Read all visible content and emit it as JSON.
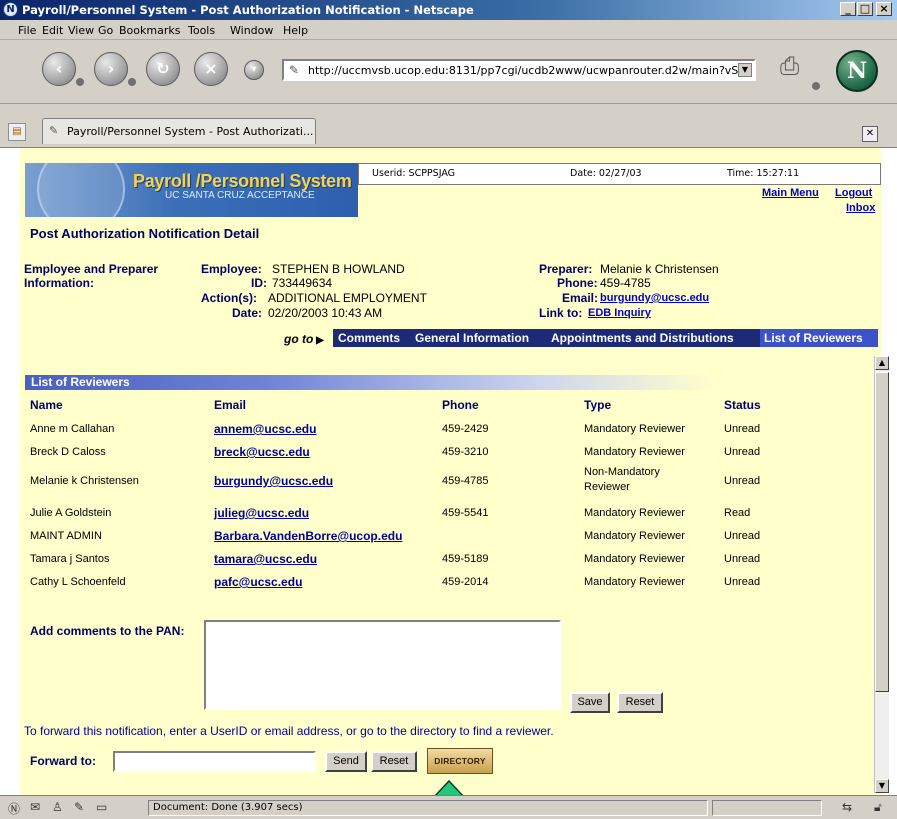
{
  "window": {
    "title": "Payroll/Personnel System - Post Authorization Notification - Netscape",
    "controls": [
      "_",
      "□",
      "×"
    ]
  },
  "menu": [
    "File",
    "Edit",
    "View",
    "Go",
    "Bookmarks",
    "Tools",
    "Window",
    "Help"
  ],
  "navigation": {
    "url": "http://uccmvsb.ucop.edu:8131/pp7cgi/ucdb2www/ucwpanrouter.d2w/main?vScr",
    "logo": "N"
  },
  "tab": {
    "title": "Payroll/Personnel System - Post Authorizati..."
  },
  "banner": {
    "title": "Payroll /Personnel System",
    "subtitle": "UC SANTA CRUZ ACCEPTANCE"
  },
  "session": {
    "userid": "Userid: SCPPSJAG",
    "date": "Date: 02/27/03",
    "time": "Time: 15:27:11"
  },
  "top_links": {
    "main_menu": "Main Menu",
    "logout": "Logout",
    "inbox": "Inbox"
  },
  "page_title": "Post Authorization Notification Detail",
  "details": {
    "section_label_line1": "Employee and Preparer",
    "section_label_line2": "Information:",
    "employee_label": "Employee:",
    "employee": "STEPHEN B HOWLAND",
    "id_label": "ID:",
    "id": "733449634",
    "actions_label": "Action(s):",
    "actions": "ADDITIONAL EMPLOYMENT",
    "date_label": "Date:",
    "date": "02/20/2003 10:43 AM",
    "preparer_label": "Preparer:",
    "preparer": "Melanie k Christensen",
    "phone_label": "Phone:",
    "phone": "459-4785",
    "email_label": "Email:",
    "email": "burgundy@ucsc.edu",
    "linkto_label": "Link to:",
    "linkto": "EDB Inquiry"
  },
  "goto": {
    "label": "go to",
    "items": [
      "Comments",
      "General Information",
      "Appointments and Distributions",
      "List of Reviewers"
    ],
    "active": "List of Reviewers"
  },
  "reviewers": {
    "heading": "List of Reviewers",
    "columns": [
      "Name",
      "Email",
      "Phone",
      "Type",
      "Status"
    ],
    "rows": [
      {
        "name": "Anne m Callahan",
        "email": "annem@ucsc.edu",
        "phone": "459-2429",
        "type": "Mandatory Reviewer",
        "status": "Unread"
      },
      {
        "name": "Breck D Caloss",
        "email": "breck@ucsc.edu",
        "phone": "459-3210",
        "type": "Mandatory Reviewer",
        "status": "Unread"
      },
      {
        "name": "Melanie k Christensen",
        "email": "burgundy@ucsc.edu",
        "phone": "459-4785",
        "type_line1": "Non-Mandatory",
        "type_line2": "Reviewer",
        "status": "Unread"
      },
      {
        "name": "Julie A Goldstein",
        "email": "julieg@ucsc.edu",
        "phone": "459-5541",
        "type": "Mandatory Reviewer",
        "status": "Read"
      },
      {
        "name": "MAINT ADMIN",
        "email": "Barbara.VandenBorre@ucop.edu",
        "phone": "",
        "type": "Mandatory Reviewer",
        "status": "Unread"
      },
      {
        "name": "Tamara j Santos",
        "email": "tamara@ucsc.edu",
        "phone": "459-5189",
        "type": "Mandatory Reviewer",
        "status": "Unread"
      },
      {
        "name": "Cathy L Schoenfeld",
        "email": "pafc@ucsc.edu",
        "phone": "459-2014",
        "type": "Mandatory Reviewer",
        "status": "Unread"
      }
    ]
  },
  "comments": {
    "label": "Add comments to the PAN:",
    "value": "",
    "save_label": "Save",
    "reset_label": "Reset"
  },
  "forward": {
    "instruction": "To forward this notification, enter a UserID or email address, or go to the directory to find a reviewer.",
    "label": "Forward to:",
    "value": "",
    "send_label": "Send",
    "reset_label": "Reset",
    "directory_label": "DIRECTORY"
  },
  "status": {
    "text": "Document: Done (3.907 secs)"
  },
  "colors": {
    "page_bg": "#ffffcc",
    "heading_navy": "#000066",
    "link_blue": "#0000cc",
    "nav_bar": "#1c2a78",
    "nav_active": "#3c52c8",
    "arrow_green": "#23c87a"
  }
}
